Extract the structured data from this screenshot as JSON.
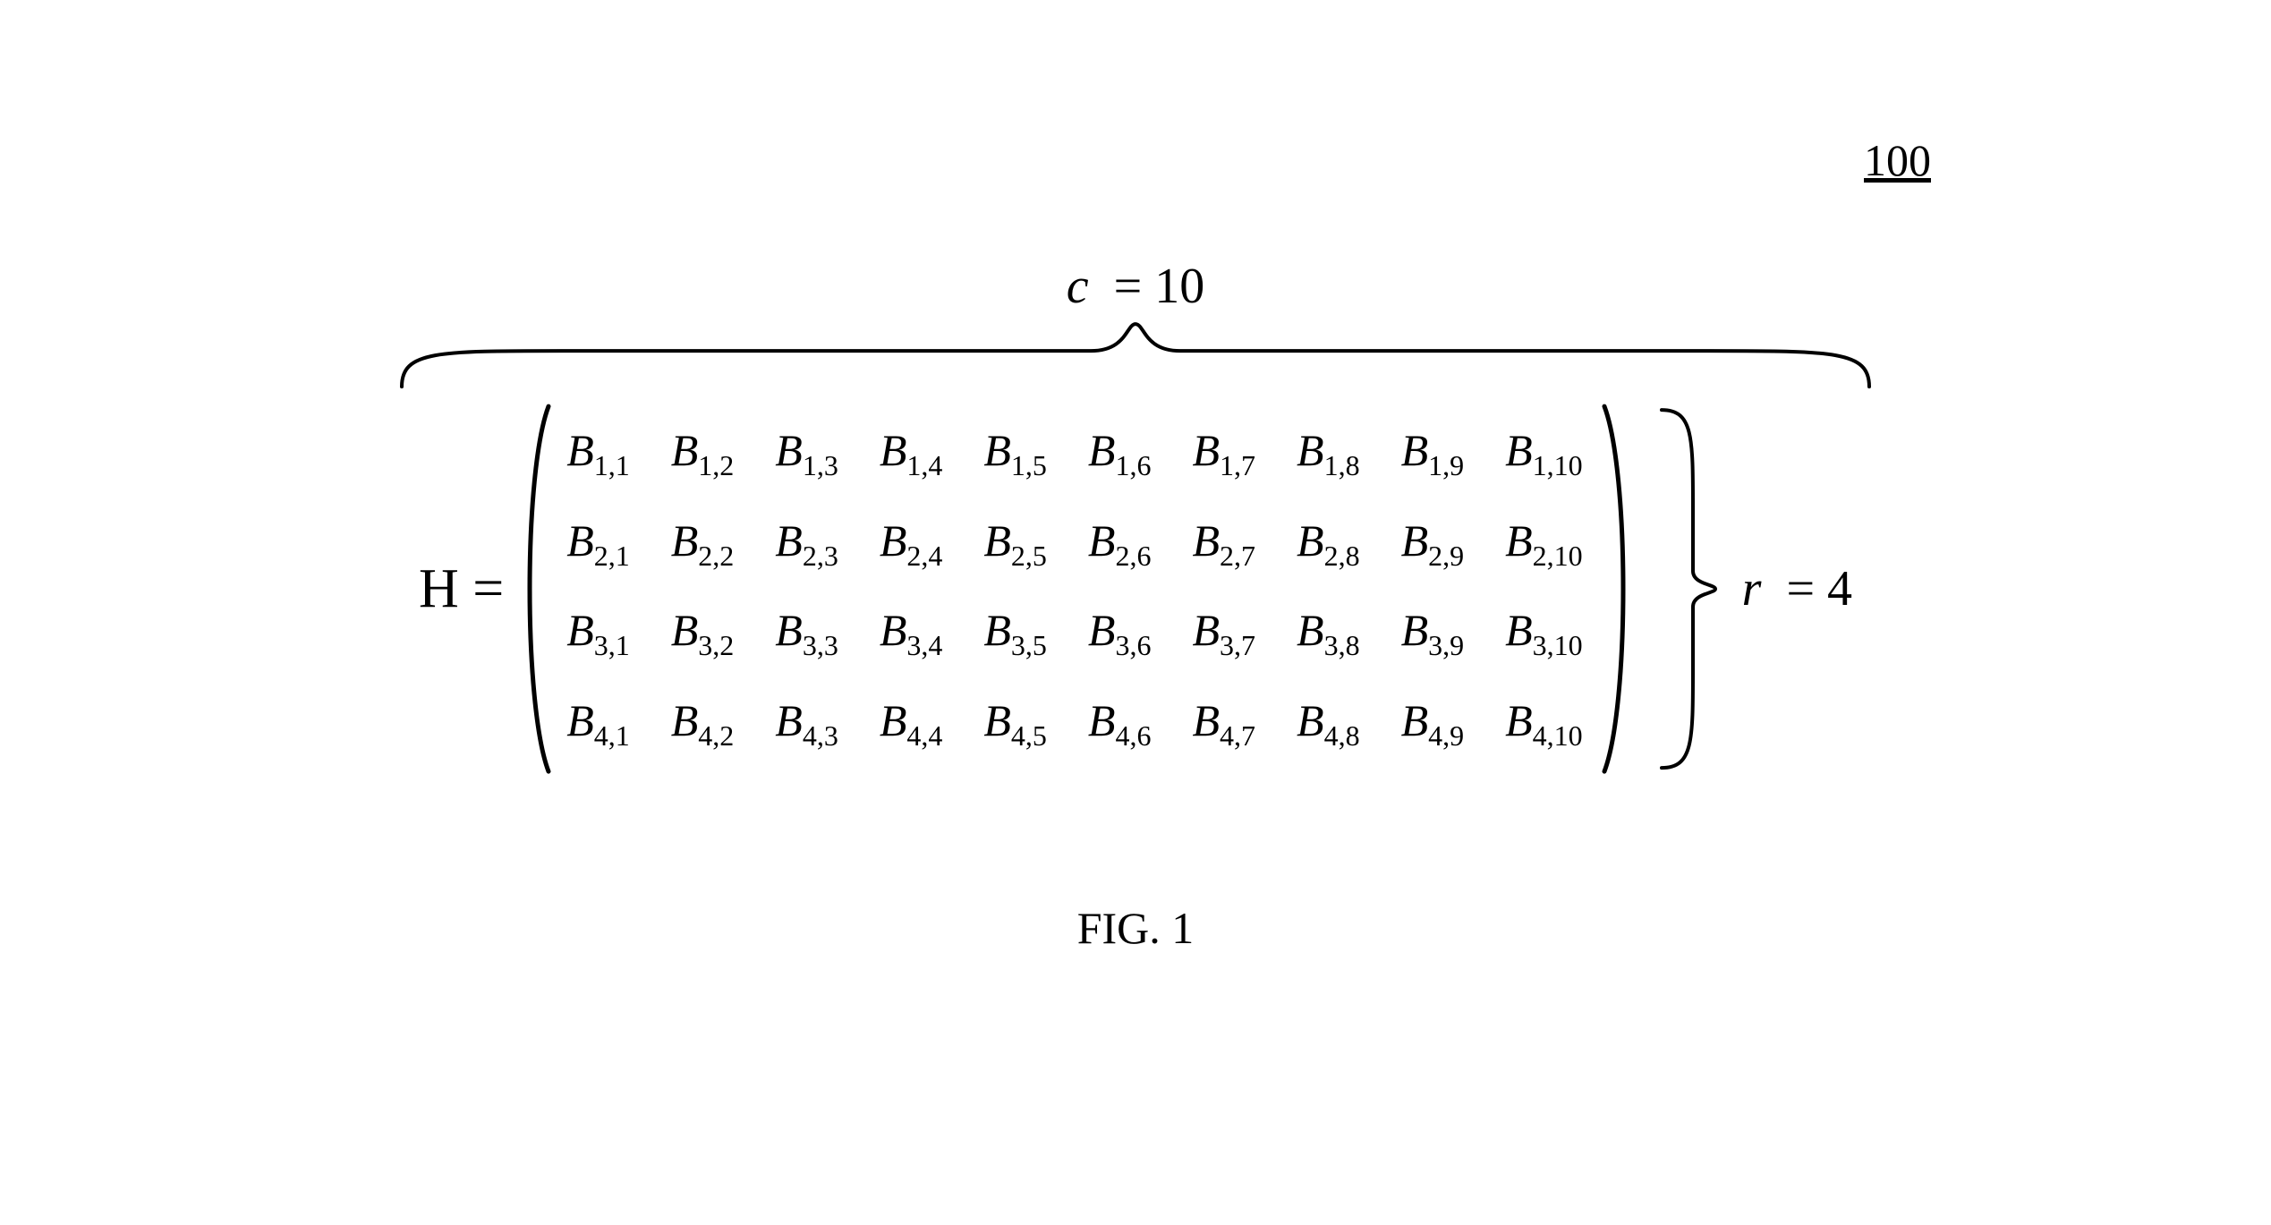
{
  "figure_number": "100",
  "caption": "FIG. 1",
  "lhs": "H =",
  "columns": {
    "symbol": "c",
    "equals": "=",
    "value": "10"
  },
  "rows": {
    "symbol": "r",
    "equals": "=",
    "value": "4"
  },
  "matrix": {
    "base_symbol": "B",
    "num_rows": 4,
    "num_cols": 10
  }
}
